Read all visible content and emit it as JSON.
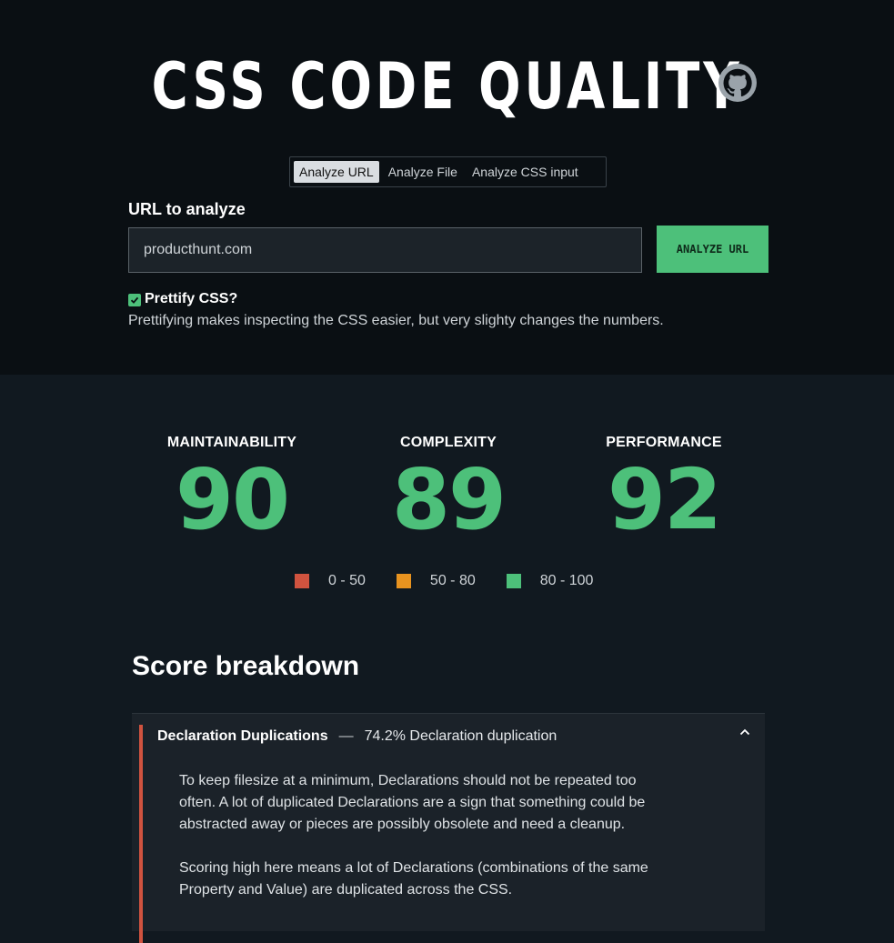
{
  "header": {
    "title": "CSS CODE QUALITY",
    "github_icon": "github-icon"
  },
  "tabs": [
    {
      "label": "Analyze URL",
      "active": true
    },
    {
      "label": "Analyze File",
      "active": false
    },
    {
      "label": "Analyze CSS input",
      "active": false
    }
  ],
  "form": {
    "url_label": "URL to analyze",
    "url_value": "producthunt.com",
    "submit_label": "ANALYZE URL",
    "prettify_checked": true,
    "prettify_label": "Prettify CSS?",
    "prettify_description": "Prettifying makes inspecting the CSS easier, but very slighty changes the numbers."
  },
  "scores": [
    {
      "label": "MAINTAINABILITY",
      "value": "90"
    },
    {
      "label": "COMPLEXITY",
      "value": "89"
    },
    {
      "label": "PERFORMANCE",
      "value": "92"
    }
  ],
  "legend": [
    {
      "label": "0 - 50",
      "color": "#d0533f"
    },
    {
      "label": "50 - 80",
      "color": "#e8931f"
    },
    {
      "label": "80 - 100",
      "color": "#4dc07a"
    }
  ],
  "breakdown": {
    "title": "Score breakdown",
    "items": [
      {
        "name": "Declaration Duplications",
        "separator": "—",
        "detail": "74.2% Declaration duplication",
        "paragraphs": [
          "To keep filesize at a minimum, Declarations should not be repeated too often. A lot of duplicated Declarations are a sign that something could be abstracted away or pieces are possibly obsolete and need a cleanup.",
          "Scoring high here means a lot of Declarations (combinations of the same Property and Value) are duplicated across the CSS."
        ]
      }
    ]
  },
  "colors": {
    "accent": "#4dc07a",
    "danger": "#d0533f",
    "warning": "#e8931f",
    "header_bg": "#0a0f13",
    "page_bg": "#111920"
  }
}
